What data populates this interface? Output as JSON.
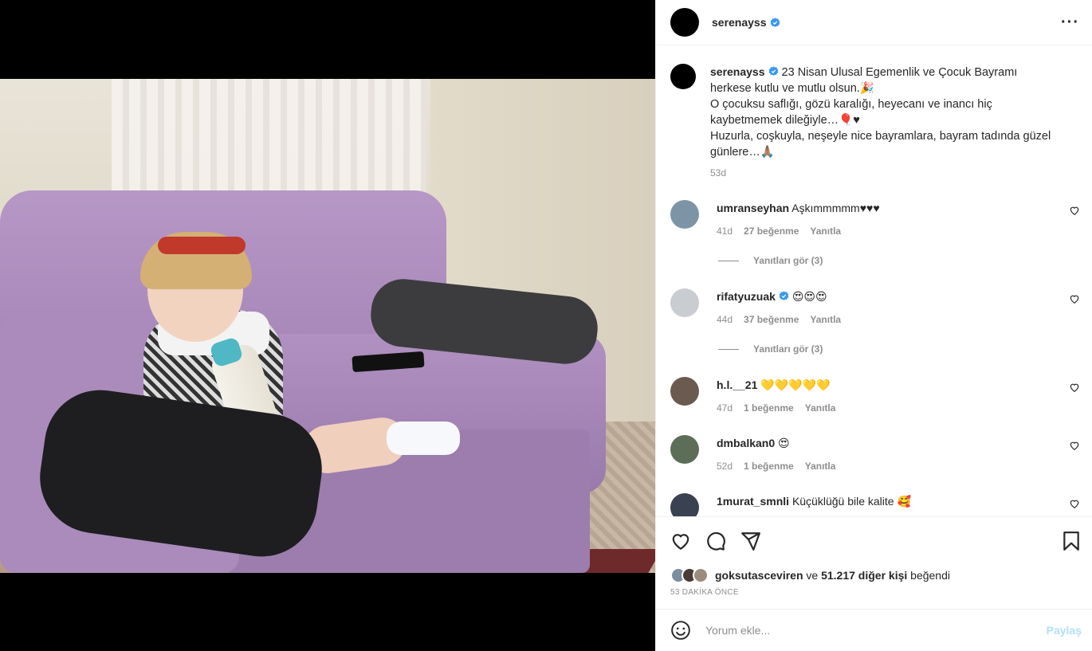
{
  "post": {
    "username": "serenayss",
    "caption_lines": [
      "23 Nisan Ulusal Egemenlik ve Çocuk Bayramı",
      "herkese kutlu ve mutlu olsun.🎉",
      "O çocuksu saflığı, gözü karalığı, heyecanı ve inancı hiç",
      "kaybetmemek dileğiyle…🎈♥",
      "Huzurla, coşkuyla, neşeyle nice bayramlara, bayram tadında güzel",
      "günlere…🙏🏽"
    ],
    "caption_time": "53d"
  },
  "comments": [
    {
      "user": "umranseyhan",
      "text": "Aşkımmmmm♥♥♥",
      "time": "41d",
      "likes": "27 beğenme",
      "reply": "Yanıtla",
      "view_replies": "Yanıtları gör (3)",
      "verified": false
    },
    {
      "user": "rifatyuzuak",
      "text": "😍😍😍",
      "time": "44d",
      "likes": "37 beğenme",
      "reply": "Yanıtla",
      "view_replies": "Yanıtları gör (3)",
      "verified": true
    },
    {
      "user": "h.l.__21",
      "text": "💛💛💛💛💛",
      "time": "47d",
      "likes": "1 beğenme",
      "reply": "Yanıtla",
      "verified": false
    },
    {
      "user": "dmbalkan0",
      "text": "😍",
      "time": "52d",
      "likes": "1 beğenme",
      "reply": "Yanıtla",
      "verified": false
    },
    {
      "user": "1murat_smnli",
      "text": "Küçüklüğü bile kalite 🥰",
      "verified": false
    }
  ],
  "likes": {
    "first_user": "goksutasceviren",
    "and": "ve",
    "others": "51.217 diğer kişi",
    "suffix": "beğendi"
  },
  "ago": "53 DAKİKA ÖNCE",
  "add_comment": {
    "placeholder": "Yorum ekle...",
    "post_label": "Paylaş"
  },
  "colors": {
    "verified": "#3897f0",
    "post_button_disabled": "#b2dffc"
  },
  "icons": [
    "more-icon",
    "verified-icon",
    "heart-icon",
    "comment-icon",
    "share-icon",
    "bookmark-icon",
    "emoji-icon"
  ]
}
